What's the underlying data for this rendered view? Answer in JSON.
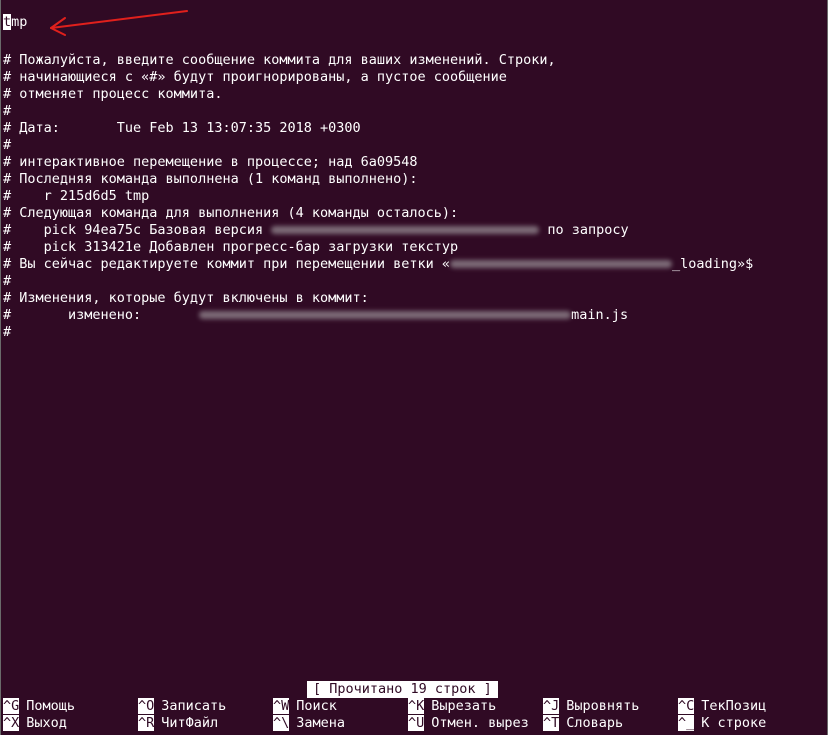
{
  "editor": {
    "first_line_cursor_char": "t",
    "first_line_rest": "mp",
    "lines": [
      "",
      "# Пожалуйста, введите сообщение коммита для ваших изменений. Строки,",
      "# начинающиеся с «#» будут проигнорированы, а пустое сообщение",
      "# отменяет процесс коммита.",
      "#",
      "# Дата:       Tue Feb 13 13:07:35 2018 +0300",
      "#",
      "# интерактивное перемещение в процессе; над 6a09548",
      "# Последняя команда выполнена (1 команд выполнено):",
      "#    r 215d6d5 tmp",
      "# Следующая команда для выполнения (4 команды осталось):"
    ],
    "pick1_prefix": "#    pick 94ea75c Базовая версия",
    "pick1_suffix": "по запросу",
    "pick2": "#    pick 313421e Добавлен прогресс-бар загрузки текстур",
    "rebase_prefix": "# Вы сейчас редактируете коммит при перемещении ветки «",
    "rebase_suffix": "_loading»$",
    "hash_line": "#",
    "changes_header": "# Изменения, которые будут включены в коммит:",
    "modified_prefix": "#       изменено:",
    "modified_suffix": "main.js",
    "last_hash": "#"
  },
  "status_message": "[ Прочитано 19 строк ]",
  "shortcuts_row1": [
    {
      "key": "^G",
      "label": "Помощь"
    },
    {
      "key": "^O",
      "label": "Записать"
    },
    {
      "key": "^W",
      "label": "Поиск"
    },
    {
      "key": "^K",
      "label": "Вырезать"
    },
    {
      "key": "^J",
      "label": "Выровнять"
    },
    {
      "key": "^C",
      "label": "ТекПозиц"
    }
  ],
  "shortcuts_row2": [
    {
      "key": "^X",
      "label": "Выход"
    },
    {
      "key": "^R",
      "label": "ЧитФайл"
    },
    {
      "key": "^\\",
      "label": "Замена"
    },
    {
      "key": "^U",
      "label": "Отмен. вырез"
    },
    {
      "key": "^T",
      "label": "Словарь"
    },
    {
      "key": "^_",
      "label": "К строке"
    }
  ],
  "colors": {
    "background": "#300a24",
    "foreground": "#ffffff",
    "annotation_arrow": "#e0201c"
  }
}
